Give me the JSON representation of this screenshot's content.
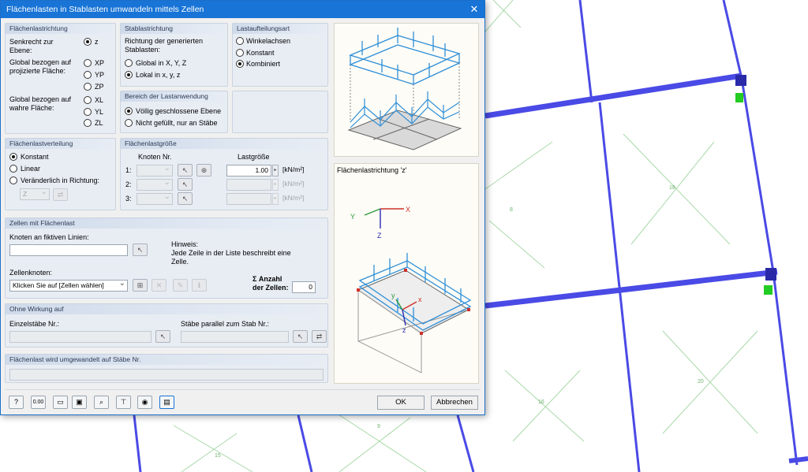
{
  "window": {
    "title": "Flächenlasten in Stablasten umwandeln mittels Zellen",
    "close_symbol": "✕"
  },
  "flaechenlastrichtung": {
    "header": "Flächenlastrichtung",
    "senkrecht_label": "Senkrecht zur Ebene:",
    "global_proj_label": "Global bezogen auf projizierte Fläche:",
    "global_wahr_label": "Global bezogen auf wahre Fläche:",
    "options": [
      "z",
      "XP",
      "YP",
      "ZP",
      "XL",
      "YL",
      "ZL"
    ],
    "selected": "z"
  },
  "stablastrichtung": {
    "header": "Stablastrichtung",
    "label": "Richtung der generierten Stablasten:",
    "options": [
      "Global in X, Y, Z",
      "Lokal in x, y, z"
    ],
    "selected": "Lokal in x, y, z"
  },
  "lastaufteilungsart": {
    "header": "Lastaufteilungsart",
    "options": [
      "Winkelachsen",
      "Konstant",
      "Kombiniert"
    ],
    "selected": "Kombiniert"
  },
  "bereich": {
    "header": "Bereich der Lastanwendung",
    "options": [
      "Völlig geschlossene Ebene",
      "Nicht gefüllt, nur an Stäbe"
    ],
    "selected": "Völlig geschlossene Ebene"
  },
  "verteilung": {
    "header": "Flächenlastverteilung",
    "options": [
      "Konstant",
      "Linear",
      "Veränderlich in Richtung:"
    ],
    "selected": "Konstant",
    "direction_value": "Z"
  },
  "groesse": {
    "header": "Flächenlastgröße",
    "knoten_header": "Knoten Nr.",
    "last_header": "Lastgröße",
    "rows": [
      {
        "label": "1:",
        "value": "1.00",
        "unit": "[kN/m²]"
      },
      {
        "label": "2:",
        "value": "",
        "unit": "[kN/m²]"
      },
      {
        "label": "3:",
        "value": "",
        "unit": "[kN/m²]"
      }
    ]
  },
  "zellen": {
    "header": "Zellen mit Flächenlast",
    "knoten_label": "Knoten an fiktiven Linien:",
    "knoten_value": "",
    "hinweis_title": "Hinweis:",
    "hinweis_text_1": "Jede Zeile in der Liste beschreibt eine",
    "hinweis_text_2": "Zelle.",
    "zellenknoten_label": "Zellenknoten:",
    "zellenknoten_value": "Klicken Sie auf [Zellen wählen]",
    "anzahl_label_1": "Σ Anzahl",
    "anzahl_label_2": "der Zellen:",
    "anzahl_value": "0"
  },
  "ohne_wirkung": {
    "header": "Ohne Wirkung auf",
    "einzelstaebe_label": "Einzelstäbe Nr.:",
    "staebe_parallel_label": "Stäbe parallel zum Stab Nr.:"
  },
  "umgewandelt": {
    "header": "Flächenlast wird umgewandelt auf Stäbe Nr."
  },
  "preview": {
    "caption": "Flächenlastrichtung 'z'",
    "axis_labels": [
      "X",
      "Y",
      "Z",
      "x",
      "y",
      "z"
    ]
  },
  "toolbar_icons": [
    "help-icon",
    "units-icon",
    "open-icon",
    "save-icon",
    "print-preview-icon",
    "member-table-icon",
    "view-icon",
    "info-panel-icon"
  ],
  "buttons": {
    "ok": "OK",
    "cancel": "Abbrechen"
  },
  "background": {
    "labels": [
      "8",
      "18",
      "16",
      "9",
      "15",
      "20"
    ]
  },
  "colors": {
    "titlebar": "#1874d6",
    "member": "#4a4ae6",
    "load_arrow": "#2f8fd8",
    "support": "#22cc22",
    "dimension_line": "#9ccf9c"
  }
}
